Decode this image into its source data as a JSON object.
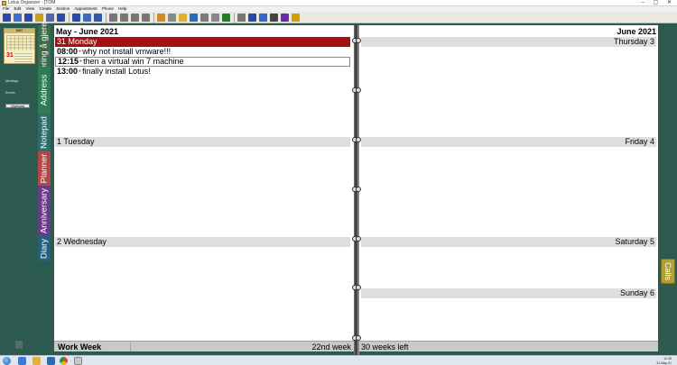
{
  "window": {
    "title": "Lotus Organizer - [TOM",
    "controls": "–  ▢  ✕"
  },
  "menu": [
    "File",
    "Edit",
    "View",
    "Create",
    "Section",
    "Appointment",
    "Phone",
    "Help"
  ],
  "toolbar_colors": [
    "#2b4aa8",
    "#3a6fcf",
    "#2b4aa8",
    "#c8a020",
    "#5566aa",
    "#2b4aa8",
    "#2b4aa8",
    "#4466bb",
    "#3355aa",
    "#777777",
    "#777777",
    "#777777",
    "#777777",
    "#d08a20",
    "#8a8a8a",
    "#e0b030",
    "#2b6ab0",
    "#7a7a7a",
    "#888888",
    "#2a7a2a",
    "#777777",
    "#2b4aa8",
    "#3366cc",
    "#444444",
    "#6a2aa8",
    "#d0a000"
  ],
  "left_panel": {
    "mini_calendar": {
      "header": "MAY",
      "day": "31"
    },
    "items": [
      "Meetings",
      "Events"
    ],
    "button": "Clipboard"
  },
  "tabs": {
    "addresses": "Address",
    "spare": "ering å gjere",
    "notepad": "Notepad",
    "planner": "Planner",
    "anniversary": "Anniversary",
    "diary": "Diary",
    "calls": "Calls"
  },
  "tab_colors": {
    "addresses": "#2e7d52",
    "spare": "#3f6b4a",
    "notepad": "#2e6b6b",
    "planner": "#b04848",
    "anniversary": "#6a3a8a",
    "diary": "#24607a",
    "calls": "#b0a038"
  },
  "left_page": {
    "header": "May - June 2021",
    "days": [
      {
        "label": "31 Monday",
        "selected": true,
        "entries": [
          {
            "time": "08:00",
            "text": "why not install vmware!!!"
          },
          {
            "time": "12:15",
            "text": "then a virtual win 7 machine"
          },
          {
            "time": "13:00",
            "text": "finally install Lotus!"
          }
        ]
      },
      {
        "label": "1 Tuesday"
      },
      {
        "label": "2 Wednesday"
      }
    ],
    "footer_left": "Work Week",
    "footer_right": "22nd week"
  },
  "right_page": {
    "header": "June 2021",
    "days": [
      {
        "label": "Thursday 3"
      },
      {
        "label": "Friday 4"
      },
      {
        "label": "Saturday 5"
      },
      {
        "label": "Sunday 6"
      }
    ],
    "footer_left": "30 weeks left"
  },
  "taskbar": {
    "time": "12:45",
    "date": "31-May-21"
  }
}
